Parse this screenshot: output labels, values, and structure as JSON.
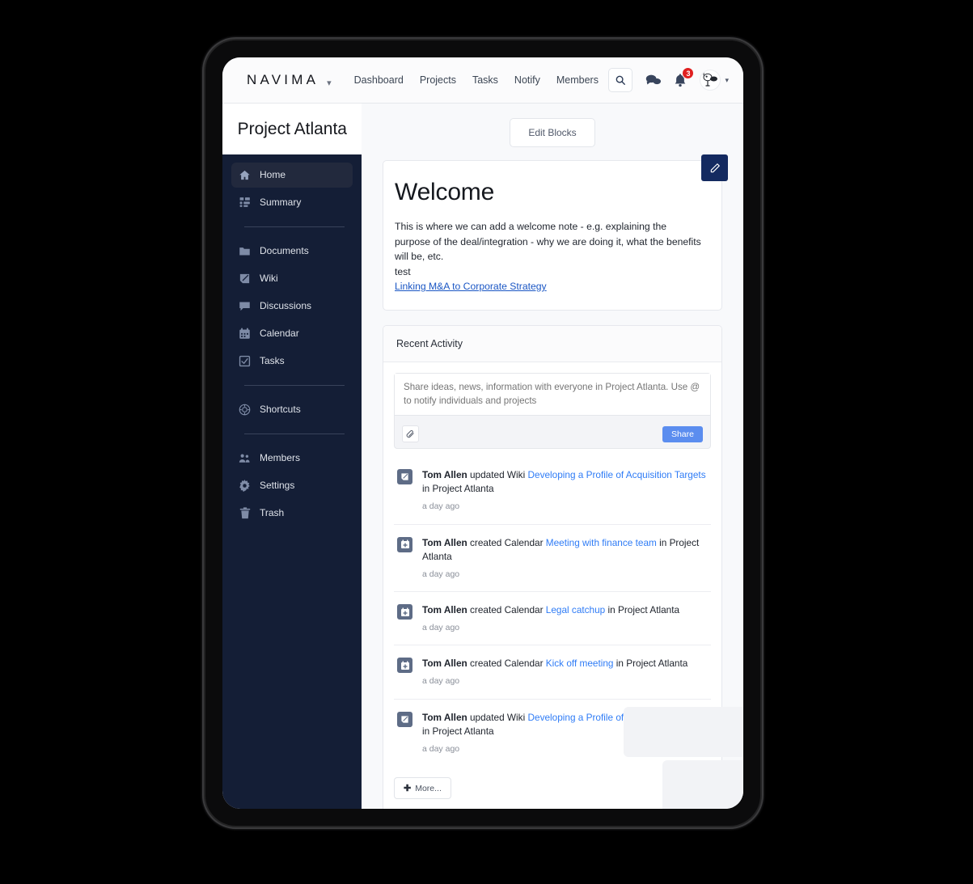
{
  "topnav": {
    "brand": "NAVIMA",
    "brand_caret_icon": "chevron-down-icon",
    "links": [
      {
        "label": "Dashboard"
      },
      {
        "label": "Projects"
      },
      {
        "label": "Tasks"
      },
      {
        "label": "Notify"
      },
      {
        "label": "Members"
      }
    ],
    "search_icon": "search-icon",
    "messages_icon": "chat-bubbles-icon",
    "notifications_icon": "bell-icon",
    "notification_count": "3",
    "avatar_icon": "user-avatar-icon",
    "avatar_caret_icon": "chevron-down-icon"
  },
  "sidebar": {
    "project_title": "Project Atlanta",
    "groups": [
      {
        "items": [
          {
            "label": "Home",
            "icon": "home-icon",
            "active": true
          },
          {
            "label": "Summary",
            "icon": "grid-icon",
            "active": false
          }
        ]
      },
      {
        "items": [
          {
            "label": "Documents",
            "icon": "folder-icon",
            "active": false
          },
          {
            "label": "Wiki",
            "icon": "pencil-square-icon",
            "active": false
          },
          {
            "label": "Discussions",
            "icon": "speech-bubble-icon",
            "active": false
          },
          {
            "label": "Calendar",
            "icon": "calendar-icon",
            "active": false
          },
          {
            "label": "Tasks",
            "icon": "checkbox-icon",
            "active": false
          }
        ]
      },
      {
        "items": [
          {
            "label": "Shortcuts",
            "icon": "compass-icon",
            "active": false
          }
        ]
      },
      {
        "items": [
          {
            "label": "Members",
            "icon": "people-icon",
            "active": false
          },
          {
            "label": "Settings",
            "icon": "gear-icon",
            "active": false
          },
          {
            "label": "Trash",
            "icon": "trash-icon",
            "active": false
          }
        ]
      }
    ]
  },
  "main": {
    "edit_blocks_label": "Edit Blocks",
    "welcome": {
      "heading": "Welcome",
      "edit_icon": "pencil-icon",
      "paragraph": "This is where we can add a welcome note - e.g. explaining the purpose of the deal/integration - why we are doing it, what the benefits will be, etc.",
      "second_line": "test",
      "link_text": "Linking M&A to Corporate Strategy"
    },
    "activity": {
      "title": "Recent Activity",
      "composer_placeholder": "Share ideas, news, information with everyone in Project Atlanta. Use @ to notify individuals and projects",
      "composer_value": "",
      "attach_icon": "paperclip-icon",
      "share_label": "Share",
      "more_label": "More...",
      "more_icon": "plus-icon",
      "items": [
        {
          "icon": "wiki-edit-icon",
          "actor": "Tom Allen",
          "verb": " updated Wiki ",
          "target": "Developing a Profile of Acquisition Targets",
          "suffix": " in Project Atlanta",
          "time": "a day ago"
        },
        {
          "icon": "calendar-plus-icon",
          "actor": "Tom Allen",
          "verb": " created Calendar ",
          "target": "Meeting with finance team",
          "suffix": " in Project Atlanta",
          "time": "a day ago"
        },
        {
          "icon": "calendar-plus-icon",
          "actor": "Tom Allen",
          "verb": " created Calendar ",
          "target": "Legal catchup",
          "suffix": " in Project Atlanta",
          "time": "a day ago"
        },
        {
          "icon": "calendar-plus-icon",
          "actor": "Tom Allen",
          "verb": " created Calendar ",
          "target": "Kick off meeting",
          "suffix": " in Project Atlanta",
          "time": "a day ago"
        },
        {
          "icon": "wiki-edit-icon",
          "actor": "Tom Allen",
          "verb": " updated Wiki ",
          "target": "Developing a Profile of Acquisition Targets",
          "suffix": " in Project Atlanta",
          "time": "a day ago"
        }
      ]
    }
  },
  "colors": {
    "sidebar_bg": "#141e36",
    "sidebar_active": "#22293d",
    "accent_blue": "#2f7cf6",
    "share_blue": "#5b8def",
    "edit_button_navy": "#142a60",
    "badge_red": "#e02020",
    "link_underline": "#1a56c4",
    "page_bg": "#f8f9fb"
  }
}
